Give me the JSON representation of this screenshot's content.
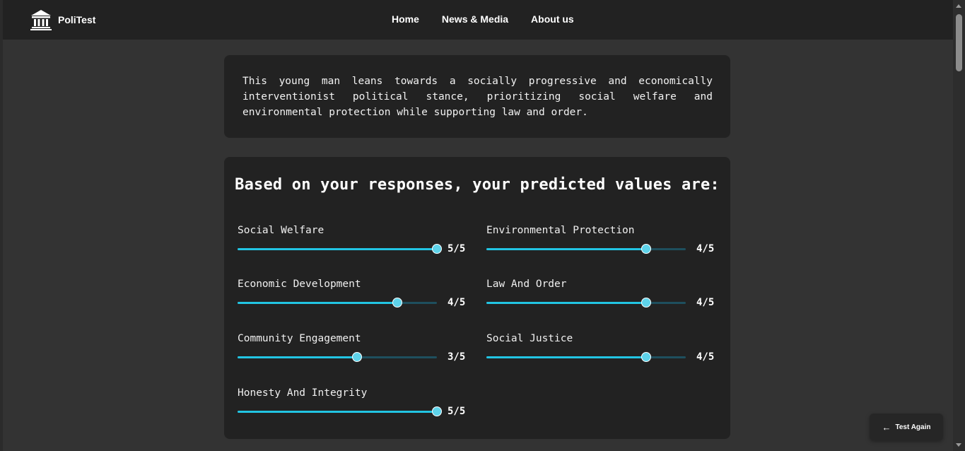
{
  "app": {
    "brand_name": "PoliTest",
    "brand_icon": "courthouse-icon"
  },
  "nav": {
    "items": [
      {
        "label": "Home"
      },
      {
        "label": "News & Media"
      },
      {
        "label": "About us"
      }
    ]
  },
  "summary": {
    "text": "This young man leans towards a socially progressive and economically interventionist political stance, prioritizing social welfare and environmental protection while supporting law and order."
  },
  "values": {
    "title": "Based on your responses, your predicted values are:",
    "max": 5,
    "accent_color": "#22c5e3",
    "track_color": "#1e4f5e",
    "items": [
      {
        "label": "Social Welfare",
        "value": 5,
        "score_text": "5/5"
      },
      {
        "label": "Environmental Protection",
        "value": 4,
        "score_text": "4/5"
      },
      {
        "label": "Economic Development",
        "value": 4,
        "score_text": "4/5"
      },
      {
        "label": "Law And Order",
        "value": 4,
        "score_text": "4/5"
      },
      {
        "label": "Community Engagement",
        "value": 3,
        "score_text": "3/5"
      },
      {
        "label": "Social Justice",
        "value": 4,
        "score_text": "4/5"
      },
      {
        "label": "Honesty And Integrity",
        "value": 5,
        "score_text": "5/5"
      }
    ]
  },
  "actions": {
    "test_again_label": "Test Again",
    "test_again_icon": "arrow-left-icon"
  }
}
